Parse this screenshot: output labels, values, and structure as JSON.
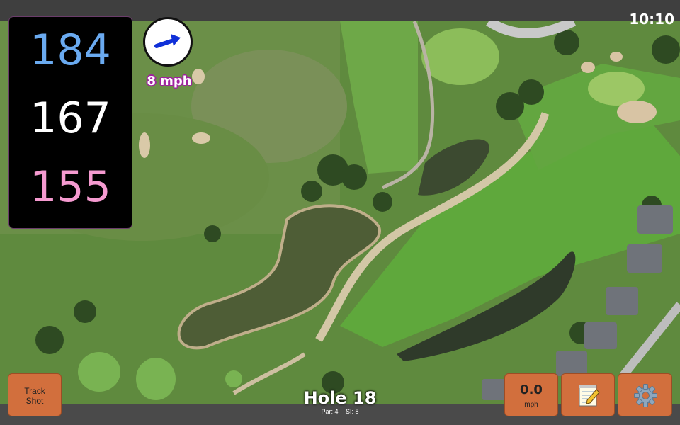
{
  "status_bar": {
    "time": "10:10"
  },
  "distances": {
    "back": "184",
    "middle": "167",
    "front": "155"
  },
  "wind": {
    "speed_label": "8 mph",
    "direction_icon": "arrow-icon"
  },
  "hole": {
    "title": "Hole 18",
    "par_label": "Par: 4",
    "si_label": "SI: 8"
  },
  "buttons": {
    "track_shot_line1": "Track",
    "track_shot_line2": "Shot",
    "speed_value": "0.0",
    "speed_unit": "mph",
    "notes_icon": "notepad-icon",
    "settings_icon": "gear-icon"
  },
  "colors": {
    "back_distance": "#6aaaf0",
    "middle_distance": "#ffffff",
    "front_distance": "#f59ad0",
    "button": "#d26f3d"
  }
}
